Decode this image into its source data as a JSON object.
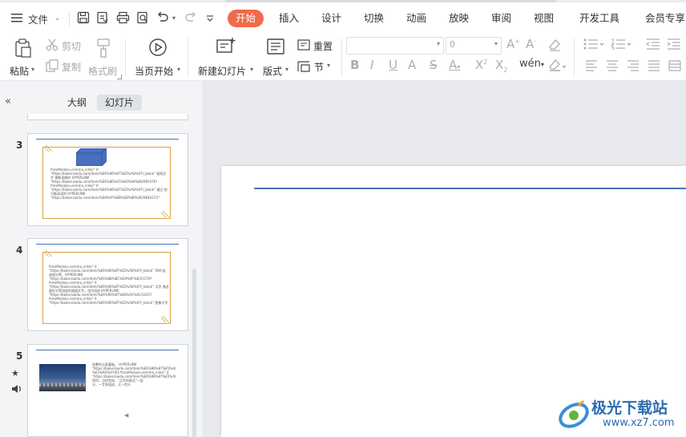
{
  "menubar": {
    "file_label": "文件",
    "tabs": [
      {
        "label": "开始",
        "active": true
      },
      {
        "label": "插入"
      },
      {
        "label": "设计"
      },
      {
        "label": "切换"
      },
      {
        "label": "动画"
      },
      {
        "label": "放映"
      },
      {
        "label": "审阅"
      },
      {
        "label": "视图"
      },
      {
        "label": "开发工具"
      },
      {
        "label": "会员专享"
      }
    ]
  },
  "ribbon": {
    "paste": "粘贴",
    "cut": "剪切",
    "copy": "复制",
    "format_painter": "格式刷",
    "play_from_current": "当页开始",
    "new_slide": "新建幻灯片",
    "layout": "版式",
    "reset": "重置",
    "section": "节",
    "font_name_value": "",
    "font_size_value": "0"
  },
  "panel": {
    "tab_outline": "大纲",
    "tab_slides": "幻灯片",
    "slides": [
      {
        "number": "3",
        "text": "fromModule=lemma_inlink\" \\t\n\"https://baike.baidu.com/item/%E6%96%87%E5%AD%97/_blank\" 图纸文\n字 理解读解的 HYPERLINK\n\"https://baike.baidu.com/item/%E6%8E%A5%E6%94%B6/995476?fromModule=lemma_inlink\" \\t\n\"https://baike.baidu.com/item/%E6%96%87%E5%AD%97/_blank\" 通过 把\n可能读读的 HYPERLINK\n\"https://baike.baidu.com/item/%E8%AF%BB%E8%80%85/984027/1\""
      },
      {
        "number": "4",
        "text": "fromModule=lemma_inlink\" \\t\n\"https://baike.baidu.com/item/%E6%96%87%E5%AD%97/_blank\" 声明 组\n成部分等。HYPERLINK\n\"https://baike.baidu.com/item/%E6%8B%BC%E9%9F%B3/1179?fromModule=lemma_inlink\" \\t\n\"https://baike.baidu.com/item/%E6%96%87%E5%AD%97/_blank\" 汉字 描述\n要形式等组成的通道文字，也作组成 HYPERLINK\n\"https://baike.baidu.com/item/%E6%96%87%E6%9C%AC/1025?fromModule=lemma_inlink\" \\t\n\"https://baike.baidu.com/item/%E6%96%87%E5%AD%97/_blank\" 图像文字"
      },
      {
        "number": "5",
        "text": "若整些分类基础。 HYPERLINK\n\"https://baike.baidu.com/item/%E6%96%87%E5%AD%97\n%E5%AD%97/61?fromModule=lemma_inlink\" \\t\n\"https://baike.baidu.com/item/%E6%96%87%E5%AD%97/_blank\" 同时，当时完成，\"汉字的表达\"一部\n分，一字多组成，又一首义"
      }
    ]
  },
  "colors": {
    "accent": "#f06a4a",
    "slide_line": "#4a70b8",
    "thumb_frame": "#d9a040",
    "cube_blue": "#4a6fc0"
  },
  "watermark": {
    "brand": "极光下载站",
    "url": "www.xz7.com"
  }
}
